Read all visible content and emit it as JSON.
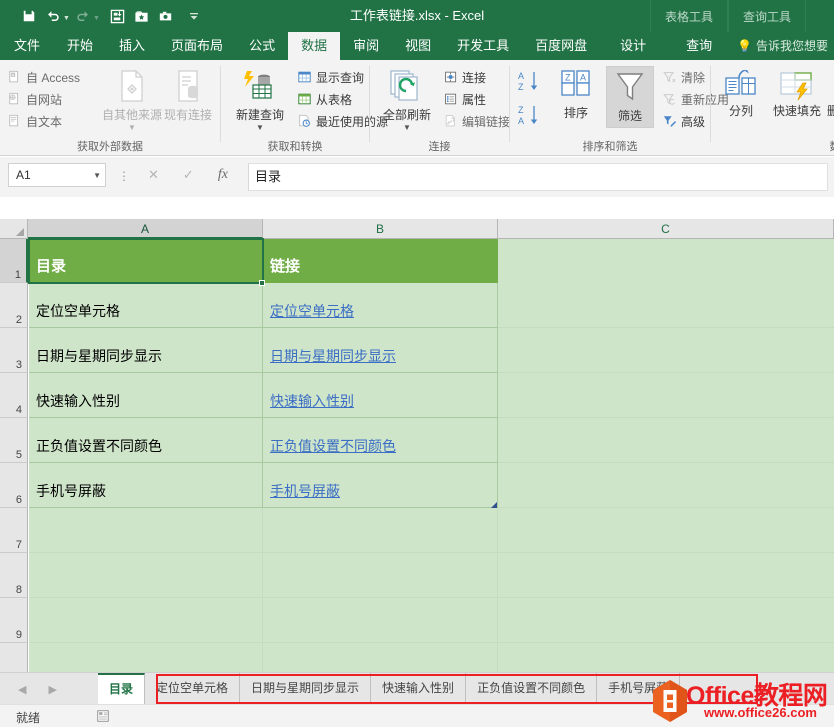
{
  "titlebar": {
    "document_title": "工作表链接.xlsx - Excel",
    "quick_access": [
      {
        "name": "save-icon",
        "glyph": "💾"
      },
      {
        "name": "undo-icon",
        "glyph": "↶"
      },
      {
        "name": "redo-icon",
        "glyph": "↷"
      },
      {
        "name": "custom-icon-1",
        "glyph": "⬜"
      },
      {
        "name": "custom-icon-2",
        "glyph": "★"
      },
      {
        "name": "camera-icon",
        "glyph": "📷"
      },
      {
        "name": "customize-qat-icon",
        "glyph": "▾"
      }
    ],
    "context_tabs": [
      {
        "label": "表格工具"
      },
      {
        "label": "查询工具"
      }
    ]
  },
  "ribbon_tabs": [
    {
      "label": "文件",
      "active": false
    },
    {
      "label": "开始",
      "active": false
    },
    {
      "label": "插入",
      "active": false
    },
    {
      "label": "页面布局",
      "active": false
    },
    {
      "label": "公式",
      "active": false
    },
    {
      "label": "数据",
      "active": true
    },
    {
      "label": "审阅",
      "active": false
    },
    {
      "label": "视图",
      "active": false
    },
    {
      "label": "开发工具",
      "active": false
    },
    {
      "label": "百度网盘",
      "active": false
    },
    {
      "label": "设计",
      "active": false
    },
    {
      "label": "查询",
      "active": false
    }
  ],
  "tell_me": "告诉我您想要",
  "ribbon_groups": [
    {
      "name": "get-external-data",
      "label": "获取外部数据",
      "small_items": [
        "自 Access",
        "自网站",
        "自文本"
      ],
      "big_items": [
        "自其他来源",
        "现有连接"
      ]
    },
    {
      "name": "get-and-transform",
      "label": "获取和转换",
      "small_items": [
        "显示查询",
        "从表格",
        "最近使用的源"
      ],
      "big_items": [
        "新建查询"
      ]
    },
    {
      "name": "connections",
      "label": "连接",
      "small_items": [
        "连接",
        "属性",
        "编辑链接"
      ],
      "big_items": [
        "全部刷新"
      ]
    },
    {
      "name": "sort-and-filter",
      "label": "排序和筛选",
      "small_items": [
        "清除",
        "重新应用",
        "高级"
      ],
      "big_items": [
        "排序",
        "筛选"
      ]
    },
    {
      "name": "data-tools",
      "label": "数",
      "small_items": [],
      "big_items": [
        "分列",
        "快速填充",
        "删除重复项"
      ]
    }
  ],
  "formula_bar": {
    "name_box_value": "A1",
    "cancel_label": "✕",
    "confirm_label": "✓",
    "function_label": "fx",
    "formula_value": "目录"
  },
  "grid": {
    "column_headers": [
      {
        "label": "A",
        "selected": true
      },
      {
        "label": "B",
        "selected": false
      },
      {
        "label": "C",
        "selected": false
      }
    ],
    "row_headers": [
      "1",
      "2",
      "3",
      "4",
      "5",
      "6",
      "7",
      "8",
      "9"
    ],
    "rows": [
      {
        "a": "目录",
        "b": "链接",
        "header": true
      },
      {
        "a": "定位空单元格",
        "b": "定位空单元格",
        "header": false
      },
      {
        "a": "日期与星期同步显示",
        "b": "日期与星期同步显示",
        "header": false
      },
      {
        "a": "快速输入性别",
        "b": "快速输入性别",
        "header": false
      },
      {
        "a": "正负值设置不同颜色",
        "b": "正负值设置不同颜色",
        "header": false
      },
      {
        "a": "手机号屏蔽",
        "b": "手机号屏蔽",
        "header": false
      },
      {
        "a": "",
        "b": "",
        "header": false
      },
      {
        "a": "",
        "b": "",
        "header": false
      },
      {
        "a": "",
        "b": "",
        "header": false
      }
    ],
    "active_cell": "A1",
    "header_fill": "#70ad47",
    "body_fill": "#cfe5ca",
    "link_color": "#3b6ec4",
    "selection_color": "#217346"
  },
  "sheet_tabs": [
    {
      "label": "目录",
      "active": true
    },
    {
      "label": "定位空单元格",
      "active": false
    },
    {
      "label": "日期与星期同步显示",
      "active": false
    },
    {
      "label": "快速输入性别",
      "active": false
    },
    {
      "label": "正负值设置不同颜色",
      "active": false
    },
    {
      "label": "手机号屏蔽",
      "active": false
    }
  ],
  "tab_nav": {
    "prev": "◀",
    "next": "▶"
  },
  "highlight_color": "#ec2024",
  "status_bar": {
    "text": "就绪"
  },
  "watermark": {
    "title": "Office教程网",
    "url": "www.office26.com",
    "color": "#ec2024"
  }
}
